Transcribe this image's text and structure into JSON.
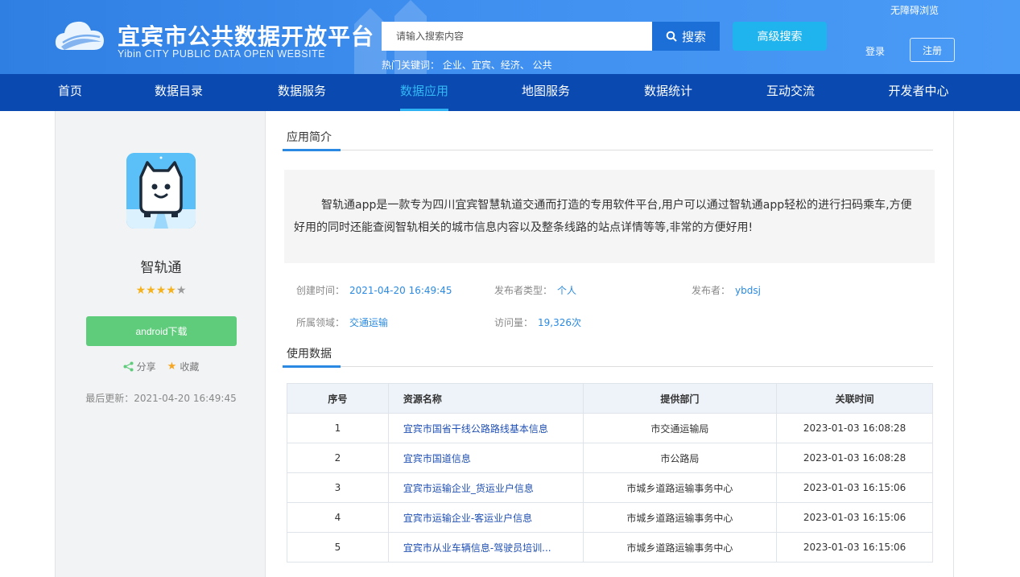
{
  "header": {
    "site_title": "宜宾市公共数据开放平台",
    "site_subtitle": "Yibin CITY PUBLIC DATA OPEN WEBSITE",
    "search_placeholder": "请输入搜索内容",
    "search_button": "搜索",
    "advanced_search": "高级搜索",
    "hot_keywords": "热门关键词：  企业、宜宾、经济、 公共",
    "accessibility": "无障碍浏览",
    "login": "登录",
    "register": "注册"
  },
  "nav": {
    "items": [
      {
        "label": "首页"
      },
      {
        "label": "数据目录"
      },
      {
        "label": "数据服务"
      },
      {
        "label": "数据应用"
      },
      {
        "label": "地图服务"
      },
      {
        "label": "数据统计"
      },
      {
        "label": "互动交流"
      },
      {
        "label": "开发者中心"
      }
    ],
    "active": "数据应用"
  },
  "app": {
    "name": "智轨通",
    "rating": 4,
    "rating_max": 5,
    "download_label": "android下载",
    "share_label": "分享",
    "favorite_label": "收藏",
    "last_update": "最后更新：2021-04-20 16:49:45",
    "icon_color": "#5bc0f8"
  },
  "intro": {
    "title": "应用简介",
    "text": "智轨通app是一款专为四川宜宾智慧轨道交通而打造的专用软件平台,用户可以通过智轨通app轻松的进行扫码乘车,方便好用的同时还能查阅智轨相关的城市信息内容以及整条线路的站点详情等等,非常的方便好用!"
  },
  "meta": {
    "created_label": "创建时间：",
    "created_value": "2021-04-20 16:49:45",
    "publisher_type_label": "发布者类型：",
    "publisher_type_value": "个人",
    "publisher_label": "发布者：",
    "publisher_value": "ybdsj",
    "domain_label": "所属领域：",
    "domain_value": "交通运输",
    "visits_label": "访问量：",
    "visits_value": "19,326次"
  },
  "usage": {
    "title": "使用数据",
    "columns": [
      "序号",
      "资源名称",
      "提供部门",
      "关联时间"
    ],
    "rows": [
      [
        "1",
        "宜宾市国省干线公路路线基本信息",
        "市交通运输局",
        "2023-01-03 16:08:28"
      ],
      [
        "2",
        "宜宾市国道信息",
        "市公路局",
        "2023-01-03 16:08:28"
      ],
      [
        "3",
        "宜宾市运输企业_货运业户信息",
        "市城乡道路运输事务中心",
        "2023-01-03 16:15:06"
      ],
      [
        "4",
        "宜宾市运输企业-客运业户信息",
        "市城乡道路运输事务中心",
        "2023-01-03 16:15:06"
      ],
      [
        "5",
        "宜宾市从业车辆信息-驾驶员培训...",
        "市城乡道路运输事务中心",
        "2023-01-03 16:15:06"
      ]
    ]
  },
  "colors": {
    "header_blue": "#3f8ff0",
    "nav_blue": "#0a4ab0",
    "accent": "#2a8ae3",
    "download_green": "#5fcc7c"
  }
}
